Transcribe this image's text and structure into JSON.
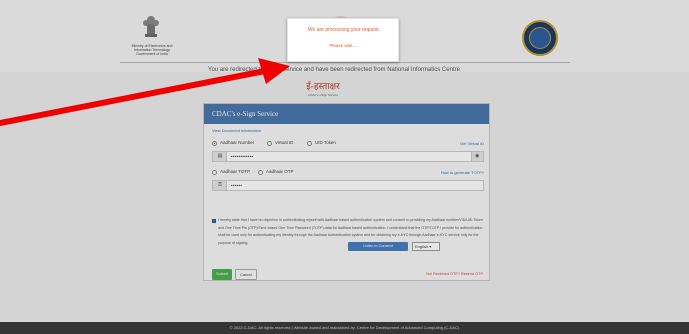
{
  "header": {
    "ministry_lines": [
      "Ministry of Electronics and",
      "Information Technology",
      "Government of India"
    ]
  },
  "redirect_notice": "You are redirected to eSign Service and have been redirected from National Informatics Centre",
  "esign": {
    "logo_text": "ई-हस्ताक्षर",
    "tagline": "CDAC's eSign Service"
  },
  "panel": {
    "title": "CDAC's e-Sign Service",
    "doc_info_label": "View Document Information",
    "id_options": [
      "Aadhaar Number",
      "Virtual ID",
      "UID Token"
    ],
    "id_selected": "Aadhaar Number",
    "get_vid_link": "Get Virtual ID",
    "aadhaar_value": "••••••••••••",
    "otp_options": [
      "Aadhaar TOTP",
      "Aadhaar OTP"
    ],
    "generate_totp_link": "How to generate TOTP?",
    "otp_value": "••••••",
    "consent_text": "I hereby state that I have no objection in authenticating myself with Aadhaar based authentication system and consent to providing my Aadhaar number/VID/UID Token and One Time Pin (OTP)/Time-based One Time Password (TOTP) data for Aadhaar based authentication. I understand that the OTP/TOTP I provide for authentication shall be used only for authenticating my identity through the Aadhaar Authentication system and for obtaining my e-KYC through Aadhaar e-KYC service only for the purpose of signing.",
    "consent_button": "Listen to Consent",
    "language": "English",
    "submit": "Submit",
    "cancel": "Cancel",
    "not_received": "Not Received OTP?",
    "resend": "Resend OTP"
  },
  "footer": "© 2022 C-DAC. All rights reserved | Website owned and maintained by: Centre for Development of Advanced Computing (C-DAC)",
  "modal": {
    "title": "We are processing your request.",
    "subtitle": "Please wait....."
  },
  "colors": {
    "panel_header": "#4a78ad",
    "arrow": "#f00000",
    "modal_text": "#e05b2a"
  },
  "icons": [
    "emblem-icon",
    "seal-icon",
    "id-card-icon",
    "key-icon",
    "eye-icon",
    "checkbox-icon",
    "arrow-annotation"
  ]
}
